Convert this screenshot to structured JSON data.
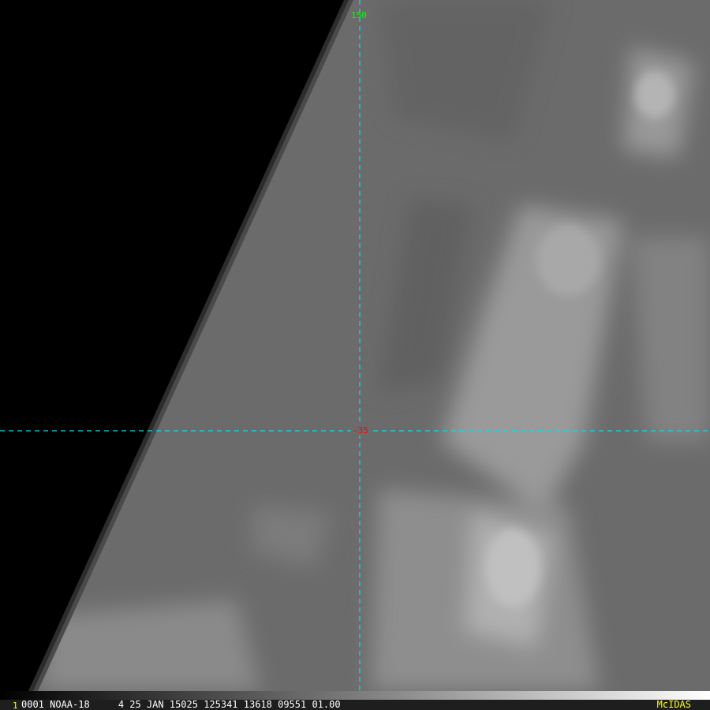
{
  "image": {
    "satellite_view": "NOAA-18 IR image"
  },
  "grid": {
    "lon_label": "150",
    "lat_label": "-35",
    "lon_color": "#00ff00",
    "lat_color": "#ff0000",
    "line_color": "#00e5e5"
  },
  "status": {
    "frame": "1",
    "info": "0001 NOAA-18     4 25 JAN 15025 125341 13618 09551 01.00",
    "brand": "McIDAS"
  }
}
